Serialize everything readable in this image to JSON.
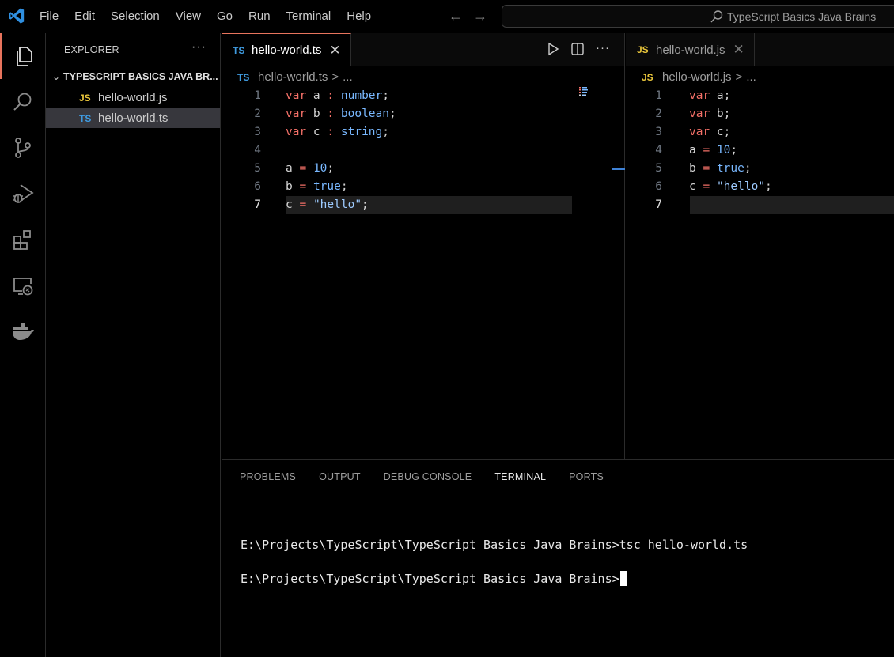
{
  "menu": [
    "File",
    "Edit",
    "Selection",
    "View",
    "Go",
    "Run",
    "Terminal",
    "Help"
  ],
  "search": {
    "text": "TypeScript Basics Java Brains"
  },
  "sidebar": {
    "title": "EXPLORER",
    "more": "···",
    "folder": "TYPESCRIPT BASICS JAVA BR...",
    "files": [
      {
        "badge": "JS",
        "name": "hello-world.js",
        "selected": false
      },
      {
        "badge": "TS",
        "name": "hello-world.ts",
        "selected": true
      }
    ]
  },
  "editor_left": {
    "tab": {
      "badge": "TS",
      "label": "hello-world.ts"
    },
    "breadcrumb": {
      "badge": "TS",
      "file": "hello-world.ts",
      "sep": ">",
      "rest": "..."
    },
    "lines": [
      {
        "n": "1",
        "tokens": [
          [
            "kw",
            "var"
          ],
          [
            "t",
            " a "
          ],
          [
            "op",
            ":"
          ],
          [
            "t",
            " "
          ],
          [
            "ty",
            "number"
          ],
          [
            "t",
            ";"
          ]
        ]
      },
      {
        "n": "2",
        "tokens": [
          [
            "kw",
            "var"
          ],
          [
            "t",
            " b "
          ],
          [
            "op",
            ":"
          ],
          [
            "t",
            " "
          ],
          [
            "ty",
            "boolean"
          ],
          [
            "t",
            ";"
          ]
        ]
      },
      {
        "n": "3",
        "tokens": [
          [
            "kw",
            "var"
          ],
          [
            "t",
            " c "
          ],
          [
            "op",
            ":"
          ],
          [
            "t",
            " "
          ],
          [
            "ty",
            "string"
          ],
          [
            "t",
            ";"
          ]
        ]
      },
      {
        "n": "4",
        "tokens": []
      },
      {
        "n": "5",
        "tokens": [
          [
            "t",
            "a "
          ],
          [
            "op",
            "="
          ],
          [
            "t",
            " "
          ],
          [
            "num",
            "10"
          ],
          [
            "t",
            ";"
          ]
        ]
      },
      {
        "n": "6",
        "tokens": [
          [
            "t",
            "b "
          ],
          [
            "op",
            "="
          ],
          [
            "t",
            " "
          ],
          [
            "num",
            "true"
          ],
          [
            "t",
            ";"
          ]
        ]
      },
      {
        "n": "7",
        "current": true,
        "tokens": [
          [
            "t",
            "c "
          ],
          [
            "op",
            "="
          ],
          [
            "t",
            " "
          ],
          [
            "str",
            "\"hello\""
          ],
          [
            "t",
            ";"
          ]
        ]
      }
    ]
  },
  "editor_right": {
    "tab": {
      "badge": "JS",
      "label": "hello-world.js"
    },
    "breadcrumb": {
      "badge": "JS",
      "file": "hello-world.js",
      "sep": ">",
      "rest": "..."
    },
    "lines": [
      {
        "n": "1",
        "tokens": [
          [
            "kw",
            "var"
          ],
          [
            "t",
            " a;"
          ]
        ]
      },
      {
        "n": "2",
        "tokens": [
          [
            "kw",
            "var"
          ],
          [
            "t",
            " b;"
          ]
        ]
      },
      {
        "n": "3",
        "tokens": [
          [
            "kw",
            "var"
          ],
          [
            "t",
            " c;"
          ]
        ]
      },
      {
        "n": "4",
        "tokens": [
          [
            "t",
            "a "
          ],
          [
            "op",
            "="
          ],
          [
            "t",
            " "
          ],
          [
            "num",
            "10"
          ],
          [
            "t",
            ";"
          ]
        ]
      },
      {
        "n": "5",
        "tokens": [
          [
            "t",
            "b "
          ],
          [
            "op",
            "="
          ],
          [
            "t",
            " "
          ],
          [
            "num",
            "true"
          ],
          [
            "t",
            ";"
          ]
        ]
      },
      {
        "n": "6",
        "tokens": [
          [
            "t",
            "c "
          ],
          [
            "op",
            "="
          ],
          [
            "t",
            " "
          ],
          [
            "str",
            "\"hello\""
          ],
          [
            "t",
            ";"
          ]
        ]
      },
      {
        "n": "7",
        "current": true,
        "tokens": []
      }
    ]
  },
  "panel": {
    "tabs": [
      "PROBLEMS",
      "OUTPUT",
      "DEBUG CONSOLE",
      "TERMINAL",
      "PORTS"
    ],
    "active_tab": "TERMINAL",
    "terminal": [
      "E:\\Projects\\TypeScript\\TypeScript Basics Java Brains>tsc hello-world.ts",
      "E:\\Projects\\TypeScript\\TypeScript Basics Java Brains>"
    ]
  },
  "colors": {
    "accent": "#e8745d",
    "keyword": "#f47068",
    "type": "#79b8ff",
    "string": "#9ecbff",
    "ts_badge": "#3f9be0",
    "js_badge": "#e8c53b"
  }
}
